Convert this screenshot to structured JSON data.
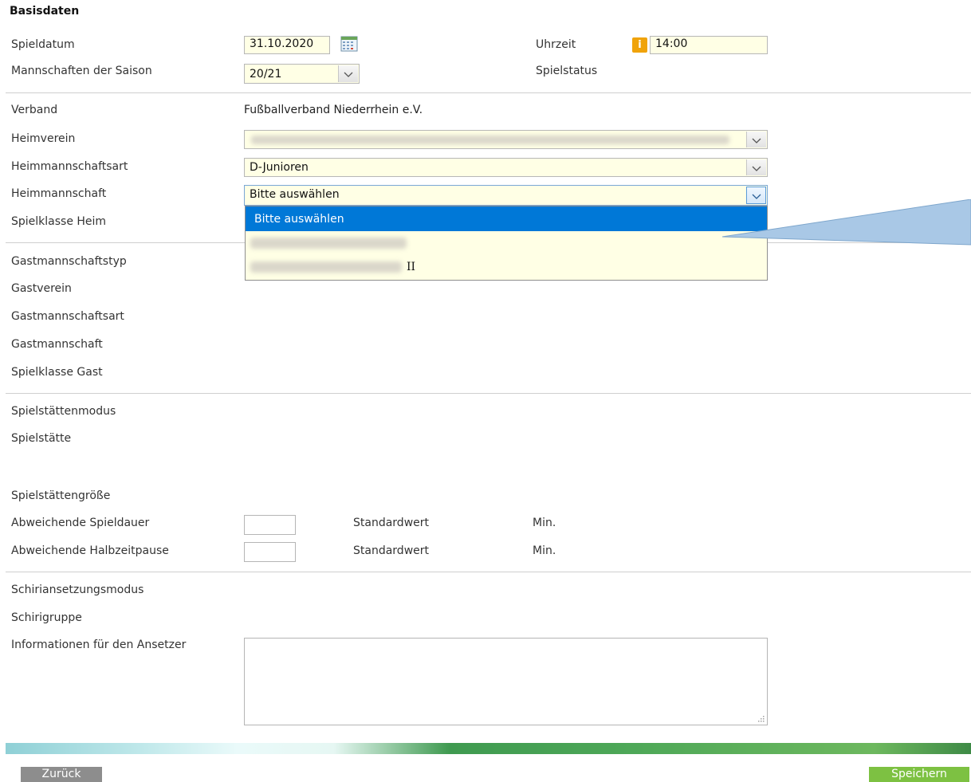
{
  "section_title": "Basisdaten",
  "labels": {
    "spieldatum": "Spieldatum",
    "mannschaften_saison": "Mannschaften der Saison",
    "uhrzeit": "Uhrzeit",
    "spielstatus": "Spielstatus",
    "verband": "Verband",
    "heimverein": "Heimverein",
    "heimmannschaftsart": "Heimmannschaftsart",
    "heimmannschaft": "Heimmannschaft",
    "spielklasse_heim": "Spielklasse Heim",
    "gastmannschaftstyp": "Gastmannschaftstyp",
    "gastverein": "Gastverein",
    "gastmannschaftsart": "Gastmannschaftsart",
    "gastmannschaft": "Gastmannschaft",
    "spielklasse_gast": "Spielklasse Gast",
    "spielstaettenmodus": "Spielstättenmodus",
    "spielstaette": "Spielstätte",
    "spielstaettengroesse": "Spielstättengröße",
    "abweichende_spieldauer": "Abweichende Spieldauer",
    "abweichende_halbzeitpause": "Abweichende Halbzeitpause",
    "schiriansetzungsmodus": "Schiriansetzungsmodus",
    "schirigruppe": "Schirigruppe",
    "informationen_ansetzer": "Informationen für den Ansetzer"
  },
  "values": {
    "spieldatum": "31.10.2020",
    "uhrzeit": "14:00",
    "saison": "20/21",
    "verband": "Fußballverband Niederrhein e.V.",
    "heimmannschaftsart": "D-Junioren",
    "heimmannschaft": "Bitte auswählen"
  },
  "dropdown": {
    "options": [
      "Bitte auswählen",
      "",
      "II"
    ],
    "selected_index": 0
  },
  "spieldauer": {
    "standard_label": "Standardwert",
    "unit": "Min."
  },
  "halbzeitpause": {
    "standard_label": "Standardwert",
    "unit": "Min."
  },
  "buttons": {
    "back": "Zurück",
    "save": "Speichern"
  },
  "icons": {
    "calendar": "calendar-icon",
    "info": "info-icon",
    "dropdown": "chevron-down-icon",
    "resize": "resize-grip-icon"
  },
  "colors": {
    "field_bg": "#ffffe5",
    "highlight": "#0078d7",
    "info": "#f0a30a",
    "save_button": "#7dc142",
    "back_button": "#8d8d8d",
    "callout": "#a9c8e6"
  }
}
